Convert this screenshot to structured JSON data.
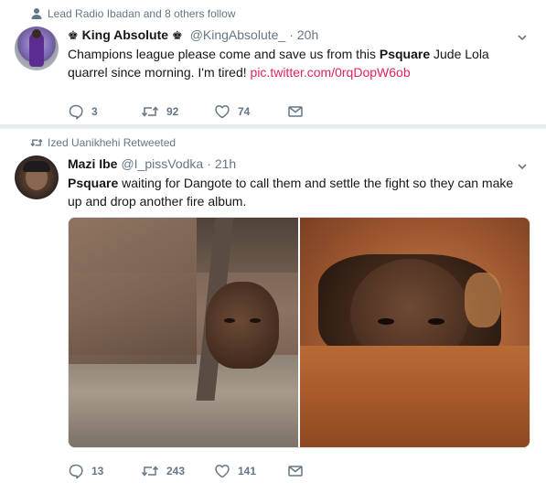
{
  "tweets": [
    {
      "context": "Lead Radio Ibadan and 8 others follow",
      "context_icon": "person-icon",
      "crown_before": "♚",
      "name": "King Absolute",
      "crown_after": "♚",
      "handle": "@KingAbsolute_",
      "separator": "·",
      "time": "20h",
      "text_before": "Champions league please come and save us from this ",
      "text_bold": "Psquare",
      "text_after": " Jude Lola quarrel since morning. I'm tired! ",
      "link": "pic.twitter.com/0rqDopW6ob",
      "replies": "3",
      "retweets": "92",
      "likes": "74"
    },
    {
      "context": "Ized Uanikhehi Retweeted",
      "context_icon": "retweet-icon",
      "name": "Mazi Ibe",
      "handle": "@I_pissVodka",
      "separator": "·",
      "time": "21h",
      "text_bold": "Psquare",
      "text_after": " waiting for Dangote to call them and settle the fight so they can make up and drop another fire album.",
      "replies": "13",
      "retweets": "243",
      "likes": "141"
    }
  ],
  "colors": {
    "accent_link": "#e0245e",
    "muted": "#657786",
    "divider": "#e6ecf0"
  },
  "icons": [
    "person-icon",
    "retweet-icon",
    "reply-icon",
    "like-icon",
    "message-icon",
    "chevron-down-icon"
  ]
}
